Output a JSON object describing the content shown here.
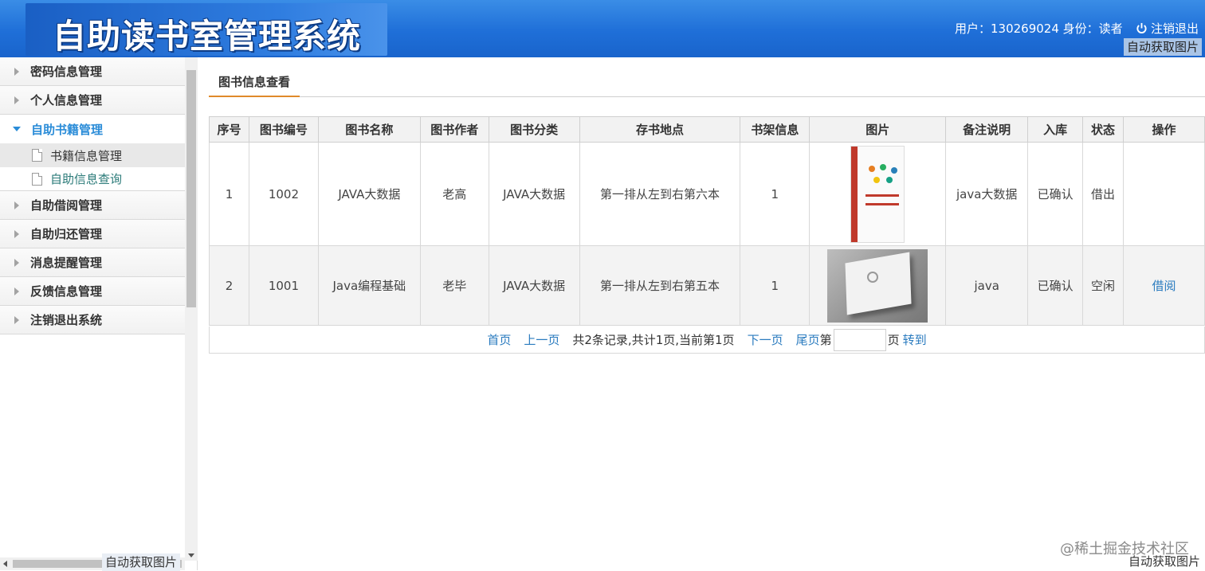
{
  "header": {
    "title": "自助读书室管理系统",
    "user_info": "用户：130269024 身份：读者",
    "logout_label": "注销退出"
  },
  "image_tags": {
    "top": "自动获取图片",
    "left": "自动获取图片",
    "right": "自动获取图片"
  },
  "sidebar": {
    "items": [
      {
        "label": "密码信息管理"
      },
      {
        "label": "个人信息管理"
      },
      {
        "label": "自助书籍管理"
      },
      {
        "label": "自助借阅管理"
      },
      {
        "label": "自助归还管理"
      },
      {
        "label": "消息提醒管理"
      },
      {
        "label": "反馈信息管理"
      },
      {
        "label": "注销退出系统"
      }
    ],
    "subitems": [
      {
        "label": "书籍信息管理"
      },
      {
        "label": "自助信息查询"
      }
    ]
  },
  "tab": {
    "label": "图书信息查看"
  },
  "table": {
    "headers": [
      "序号",
      "图书编号",
      "图书名称",
      "图书作者",
      "图书分类",
      "存书地点",
      "书架信息",
      "图片",
      "备注说明",
      "入库",
      "状态",
      "操作"
    ],
    "rows": [
      {
        "no": "1",
        "code": "1002",
        "name": "JAVA大数据",
        "author": "老高",
        "category": "JAVA大数据",
        "location": "第一排从左到右第六本",
        "shelf": "1",
        "note": "java大数据",
        "stock": "已确认",
        "status": "借出",
        "action": ""
      },
      {
        "no": "2",
        "code": "1001",
        "name": "Java编程基础",
        "author": "老毕",
        "category": "JAVA大数据",
        "location": "第一排从左到右第五本",
        "shelf": "1",
        "note": "java",
        "stock": "已确认",
        "status": "空闲",
        "action": "借阅"
      }
    ]
  },
  "pager": {
    "first": "首页",
    "prev": "上一页",
    "summary": "共2条记录,共计1页,当前第1页",
    "next": "下一页",
    "last": "尾页",
    "page_prefix": "第",
    "page_suffix": "页",
    "go": "转到"
  },
  "watermark": "@稀土掘金技术社区"
}
